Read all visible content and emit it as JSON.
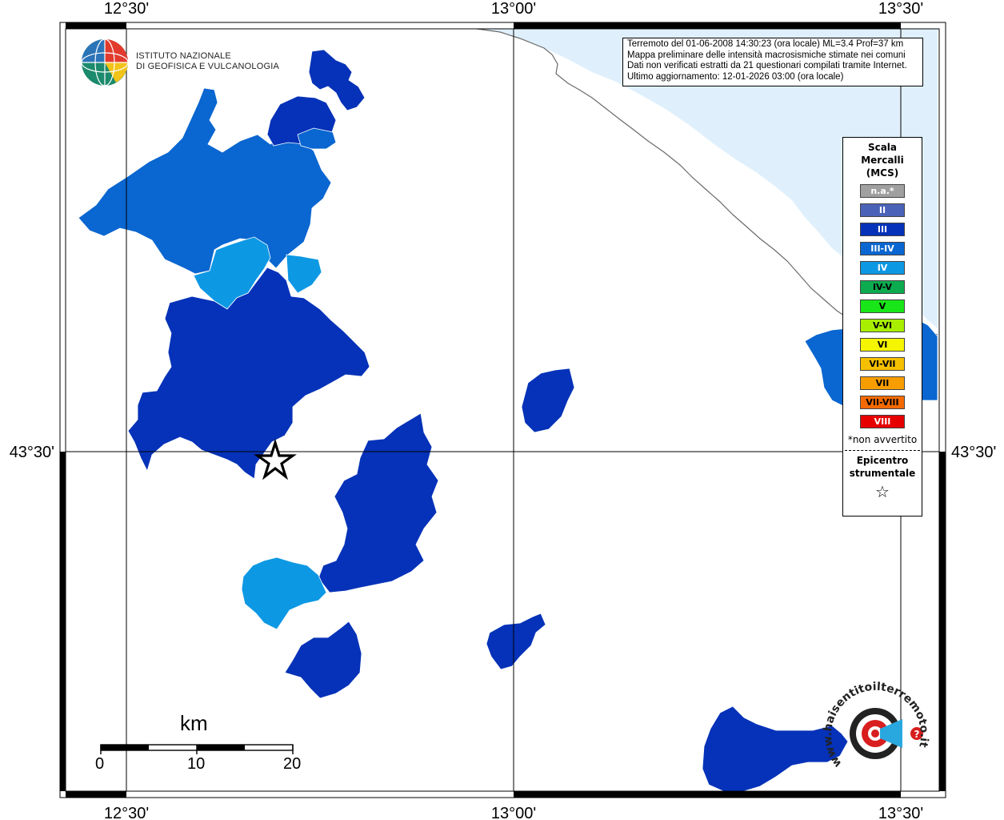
{
  "map": {
    "grid_labels": {
      "top": [
        "12°30'",
        "13°00'",
        "13°30'"
      ],
      "bottom": [
        "12°30'",
        "13°00'",
        "13°30'"
      ],
      "left": "43°30'",
      "right": "43°30'"
    },
    "colors": {
      "sea": "#dff0fc",
      "na": "#a0a0a0",
      "II": "#4a62b8",
      "III": "#0532b8",
      "III-IV": "#0a66d0",
      "IV": "#0d98e4",
      "IV-V": "#0dab4f",
      "V": "#19e619",
      "V-VI": "#a8ee00",
      "VI": "#f5f500",
      "VI-VII": "#f4c000",
      "VII": "#f79d00",
      "VII-VIII": "#f46a00",
      "VIII": "#e60000"
    }
  },
  "info": {
    "line1": "Terremoto del 01-06-2008 14:30:23 (ora locale) ML=3.4 Prof=37 km",
    "line2": "Mappa preliminare delle intensità macrosismiche stimate nei comuni",
    "line3": "Dati non verificati estratti da 21 questionari compilati tramite Internet.",
    "line4": "Ultimo aggiornamento: 12-01-2026 03:00 (ora locale)"
  },
  "logo": {
    "line1": "ISTITUTO NAZIONALE",
    "line2": "DI GEOFISICA E VULCANOLOGIA"
  },
  "legend": {
    "title1": "Scala",
    "title2": "Mercalli",
    "title3": "(MCS)",
    "items": [
      {
        "label": "n.a.*",
        "color": "#a0a0a0",
        "text_color": "#ffffff"
      },
      {
        "label": "II",
        "color": "#4a62b8",
        "text_color": "#ffffff"
      },
      {
        "label": "III",
        "color": "#0532b8",
        "text_color": "#ffffff"
      },
      {
        "label": "III-IV",
        "color": "#0a66d0",
        "text_color": "#ffffff"
      },
      {
        "label": "IV",
        "color": "#0d98e4",
        "text_color": "#ffffff"
      },
      {
        "label": "IV-V",
        "color": "#0dab4f",
        "text_color": "#000000"
      },
      {
        "label": "V",
        "color": "#19e619",
        "text_color": "#000000"
      },
      {
        "label": "V-VI",
        "color": "#a8ee00",
        "text_color": "#000000"
      },
      {
        "label": "VI",
        "color": "#f5f500",
        "text_color": "#000000"
      },
      {
        "label": "VI-VII",
        "color": "#f4c000",
        "text_color": "#000000"
      },
      {
        "label": "VII",
        "color": "#f79d00",
        "text_color": "#000000"
      },
      {
        "label": "VII-VIII",
        "color": "#f46a00",
        "text_color": "#000000"
      },
      {
        "label": "VIII",
        "color": "#e60000",
        "text_color": "#ffffff"
      }
    ],
    "note": "*non avvertito",
    "epi1": "Epicentro",
    "epi2": "strumentale",
    "star": "☆"
  },
  "scale_bar": {
    "title": "km",
    "labels": [
      "0",
      "10",
      "20"
    ]
  },
  "watermark": {
    "text": "www.haisentitoilterremoto.it",
    "icon": "target-loudspeaker-icon"
  }
}
